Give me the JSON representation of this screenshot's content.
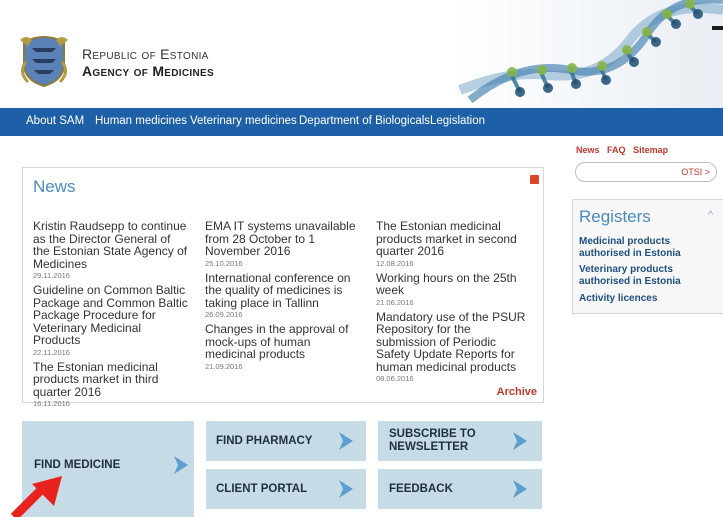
{
  "header": {
    "org_line1": "Republic of Estonia",
    "org_line2": "Agency of Medicines"
  },
  "nav": {
    "items": [
      {
        "label": "About SAM"
      },
      {
        "label": "Human medicines"
      },
      {
        "label": "Veterinary medicines"
      },
      {
        "label": "Department of Biologicals"
      },
      {
        "label": "Legislation"
      }
    ]
  },
  "toplinks": {
    "news": "News",
    "faq": "FAQ",
    "sitemap": "Sitemap"
  },
  "search": {
    "button_label": "OTSI >",
    "placeholder": ""
  },
  "news": {
    "title": "News",
    "archive_label": "Archive",
    "columns": [
      [
        {
          "headline": "Kristin Raudsepp to continue as the Director General of the Estonian State Agency of Medicines",
          "date": "29.11.2016"
        },
        {
          "headline": "Guideline on Common Baltic Package and Common Baltic Package Procedure for Veterinary Medicinal Products",
          "date": "22.11.2016"
        },
        {
          "headline": "The Estonian medicinal products market in third quarter 2016",
          "date": "16.11.2016"
        }
      ],
      [
        {
          "headline": "EMA IT systems unavailable from 28 October to 1 November 2016",
          "date": "25.10.2016"
        },
        {
          "headline": "International conference on the quality of medicines is taking place in Tallinn",
          "date": "26.09.2016"
        },
        {
          "headline": "Changes in the approval of mock-ups of human medicinal products",
          "date": "21.09.2016"
        }
      ],
      [
        {
          "headline": "The Estonian medicinal products market in second quarter 2016",
          "date": "12.08.2016"
        },
        {
          "headline": "Working hours on the 25th week",
          "date": "21.06.2016"
        },
        {
          "headline": "Mandatory use of the PSUR Repository for the submission of Periodic Safety Update Reports for human medicinal products",
          "date": "08.06.2016"
        }
      ]
    ]
  },
  "registers": {
    "title": "Registers",
    "links": [
      {
        "label": "Medicinal products authorised in Estonia"
      },
      {
        "label": "Veterinary products authorised in Estonia"
      },
      {
        "label": "Activity licences"
      }
    ]
  },
  "tiles": {
    "find_medicine": "FIND MEDICINE",
    "find_pharmacy": "FIND PHARMACY",
    "subscribe": "SUBSCRIBE TO NEWSLETTER",
    "client_portal": "CLIENT PORTAL",
    "feedback": "FEEDBACK"
  },
  "colors": {
    "nav_bg": "#1e60a7",
    "accent_red": "#c0392b",
    "heading_blue": "#4a8bc0",
    "tile_bg": "#c7dbe7",
    "tile_arrow": "#5d9ed0",
    "annotation_arrow": "#e8221c"
  },
  "icons": [
    "coat-of-arms-icon",
    "dna-helix-image",
    "rss-icon",
    "chevron-up-icon",
    "chevron-right-icon",
    "red-pointer-arrow"
  ]
}
